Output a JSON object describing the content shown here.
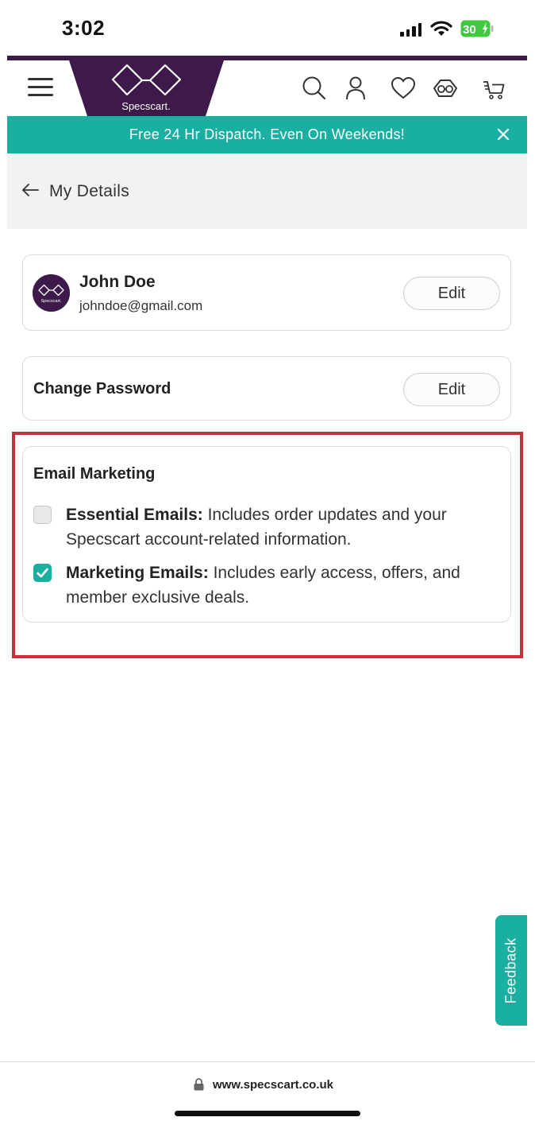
{
  "status_bar": {
    "time": "3:02",
    "battery": "30"
  },
  "header": {
    "logo_text": "Specscart.",
    "icons": [
      "menu-icon",
      "search-icon",
      "user-icon",
      "heart-icon",
      "eyeglasses-icon",
      "cart-icon"
    ],
    "brand_color": "#3d1a4a"
  },
  "banner": {
    "text": "Free 24 Hr Dispatch. Even On Weekends!",
    "color": "#19b0a2"
  },
  "page": {
    "title": "My Details"
  },
  "profile": {
    "avatar_text": "Specscart.",
    "name": "John Doe",
    "email": "johndoe@gmail.com",
    "edit_label": "Edit"
  },
  "password": {
    "title": "Change Password",
    "edit_label": "Edit"
  },
  "email_marketing": {
    "title": "Email Marketing",
    "options": [
      {
        "label": "Essential Emails:",
        "description": " Includes order updates and your Specscart account-related information.",
        "checked": false
      },
      {
        "label": "Marketing Emails:",
        "description": " Includes early access, offers, and member exclusive deals.",
        "checked": true
      }
    ],
    "highlight_color": "#c8303a"
  },
  "feedback": {
    "label": "Feedback"
  },
  "url_bar": {
    "url": "www.specscart.co.uk"
  }
}
